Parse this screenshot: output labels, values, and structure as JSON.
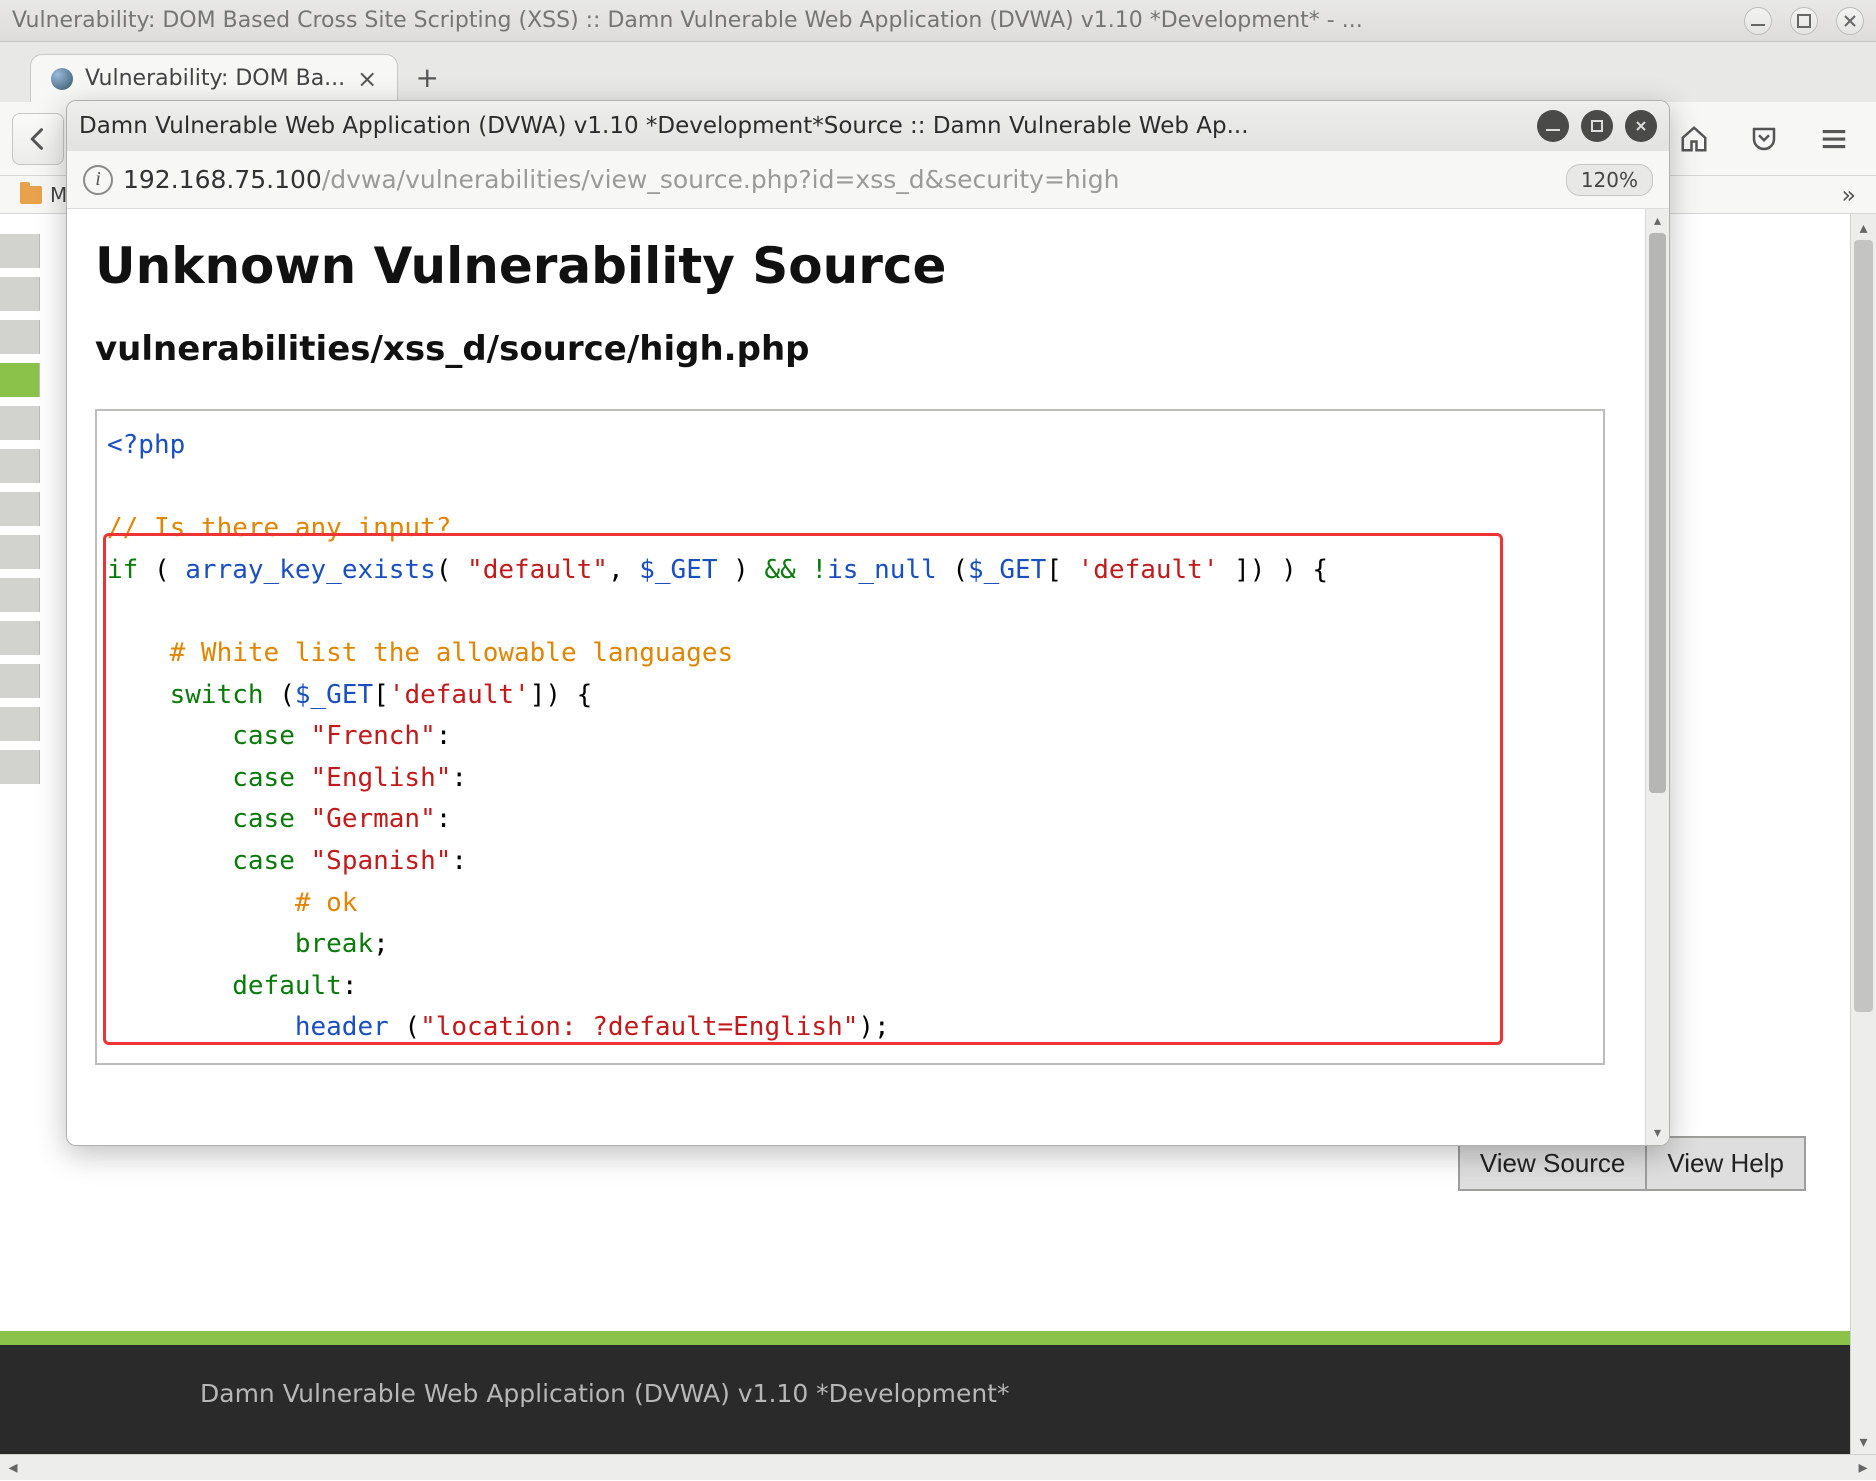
{
  "os": {
    "title": "Vulnerability: DOM Based Cross Site Scripting (XSS) :: Damn Vulnerable Web Application (DVWA) v1.10 *Development* - ..."
  },
  "browser": {
    "tab_label": "Vulnerability: DOM Ba...",
    "bookmarks_item": "M",
    "right_chevron": "»"
  },
  "popup": {
    "title": "Damn Vulnerable Web Application (DVWA) v1.10 *Development*Source :: Damn Vulnerable Web Ap...",
    "url_host": "192.168.75.100",
    "url_path": "/dvwa/vulnerabilities/view_source.php?id=xss_d&security=high",
    "zoom": "120%",
    "h1": "Unknown Vulnerability Source",
    "h2": "vulnerabilities/xss_d/source/high.php",
    "code": {
      "l1a": "<?php",
      "l3": "// Is there any input?",
      "l4_if": "if",
      "l4_fn1": "array_key_exists",
      "l4_s1": "\"default\"",
      "l4_v1": "$_GET",
      "l4_op": "&& !",
      "l4_fn2": "is_null",
      "l4_v2": "$_GET",
      "l4_s2": "'default'",
      "l6": "# White list the allowable languages",
      "l7_sw": "switch",
      "l7_v": "$_GET",
      "l7_s": "'default'",
      "l8c": "case",
      "l8s": "\"French\"",
      "l9s": "\"English\"",
      "l10s": "\"German\"",
      "l11s": "\"Spanish\"",
      "l12": "# ok",
      "l13": "break",
      "l14": "default",
      "l15f": "header",
      "l15s": "\"location: ?default=English\""
    }
  },
  "dvwa": {
    "view_source": "View Source",
    "view_help": "View Help",
    "footer": "Damn Vulnerable Web Application (DVWA) v1.10 *Development*"
  }
}
